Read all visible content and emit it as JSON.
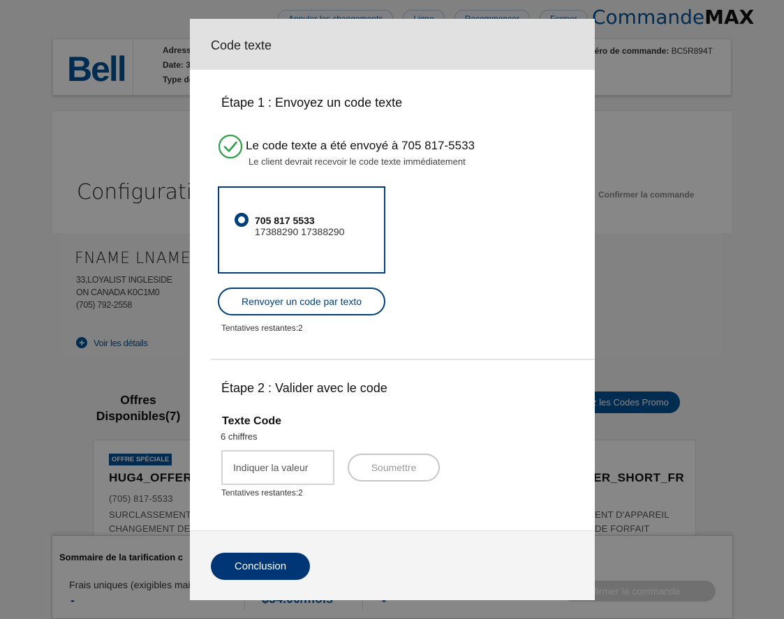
{
  "top_nav": {
    "buttons": [
      "Annuler les changements",
      "Ligne",
      "Recommencer",
      "Fermer"
    ]
  },
  "brand": {
    "prefix": "Commande",
    "suffix": "MAX"
  },
  "header": {
    "logo": "Bell",
    "address_label": "Adress",
    "date_label": "Date: 3",
    "type_label": "Type de",
    "order_label": "éro de commande:",
    "order_value": "BC5R894T"
  },
  "page": {
    "title": "Configuratio",
    "confirm_step": "Confirmer la commande"
  },
  "customer": {
    "name": "FNAME LNAME",
    "address1": "33,LOYALIST INGLESIDE",
    "address2": "ON CANADA K0C1M0",
    "phone": "(705) 792-2558",
    "details_link": "Voir les détails"
  },
  "offers": {
    "title": "Offres Disponibles(7)",
    "promo_button": "z les Codes Promo",
    "cards": [
      {
        "badge": "OFFRE SPÉCIALE",
        "title": "HUG4_OFFER",
        "phone": "(705) 817-5533",
        "line1": "SURCLASSEMENT",
        "line2": "CHANGEMENT DE"
      },
      {
        "title": "ER_SHORT_FR",
        "line1": "ENT D'APPAREIL",
        "line2": "DE FORFAIT"
      }
    ]
  },
  "pricing": {
    "title": "Sommaire de la tarification c",
    "one_time_label": "Frais uniques (exigibles mai",
    "dash": "-",
    "monthly": "$54.00/mois",
    "confirm_button": "nfirmer la commande"
  },
  "modal": {
    "title": "Code texte",
    "step1_title": "Étape 1 : Envoyez un code texte",
    "sent_message": "Le code texte a été envoyé à 705 817-5533",
    "sent_sub": "Le client devrait recevoir le code texte immédiatement",
    "phone_option": {
      "number": "705 817 5533",
      "id": "17388290 17388290"
    },
    "resend_button": "Renvoyer un code par texto",
    "attempts_1": "Tentatives restantes:2",
    "step2_title": "Étape 2 : Valider avec le code",
    "code_label": "Texte Code",
    "code_hint": "6 chiffres",
    "code_placeholder": "Indiquer la valeur",
    "submit_button": "Soumettre",
    "attempts_2": "Tentatives restantes:2",
    "conclusion_button": "Conclusion"
  },
  "colors": {
    "bell_blue": "#00549a",
    "dark_blue": "#003676",
    "success_green": "#2e9e48"
  }
}
